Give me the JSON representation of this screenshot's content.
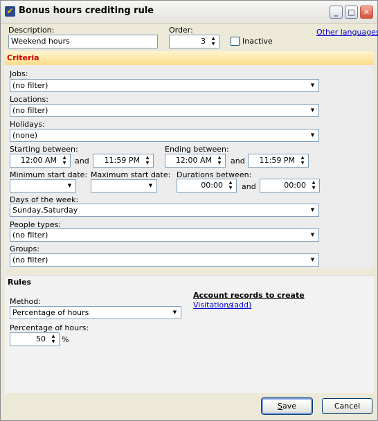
{
  "window": {
    "title": "Bonus hours crediting rule"
  },
  "top": {
    "description_label": "Description:",
    "description_value": "Weekend hours",
    "order_label": "Order:",
    "order_value": "3",
    "inactive_label": "Inactive",
    "inactive_checked": false,
    "other_languages": "Other languages"
  },
  "criteria": {
    "header": "Criteria",
    "jobs_label": "Jobs:",
    "jobs_value": "(no filter)",
    "locations_label": "Locations:",
    "locations_value": "(no filter)",
    "holidays_label": "Holidays:",
    "holidays_value": "(none)",
    "starting_label": "Starting between:",
    "starting_from": "12:00 AM",
    "starting_to": "11:59 PM",
    "ending_label": "Ending between:",
    "ending_from": "12:00 AM",
    "ending_to": "11:59 PM",
    "and": "and",
    "min_start_label": "Minimum start date:",
    "min_start_value": "",
    "max_start_label": "Maximum start date:",
    "max_start_value": "",
    "durations_label": "Durations between:",
    "durations_from": "00:00",
    "durations_to": "00:00",
    "days_label": "Days of the week:",
    "days_value": "Sunday,Saturday",
    "people_label": "People types:",
    "people_value": "(no filter)",
    "groups_label": "Groups:",
    "groups_value": "(no filter)"
  },
  "rules": {
    "header": "Rules",
    "method_label": "Method:",
    "method_value": "Percentage of hours",
    "account_title": "Account records to create",
    "account_link1": "Visitations",
    "account_sep": ",",
    "account_link2": "(add)",
    "percent_label": "Percentage of hours:",
    "percent_value": "50",
    "percent_unit": "%"
  },
  "buttons": {
    "save_accel": "S",
    "save_rest": "ave",
    "cancel": "Cancel"
  },
  "colors": {
    "header_text": "#d00000",
    "link": "#0000d8"
  }
}
